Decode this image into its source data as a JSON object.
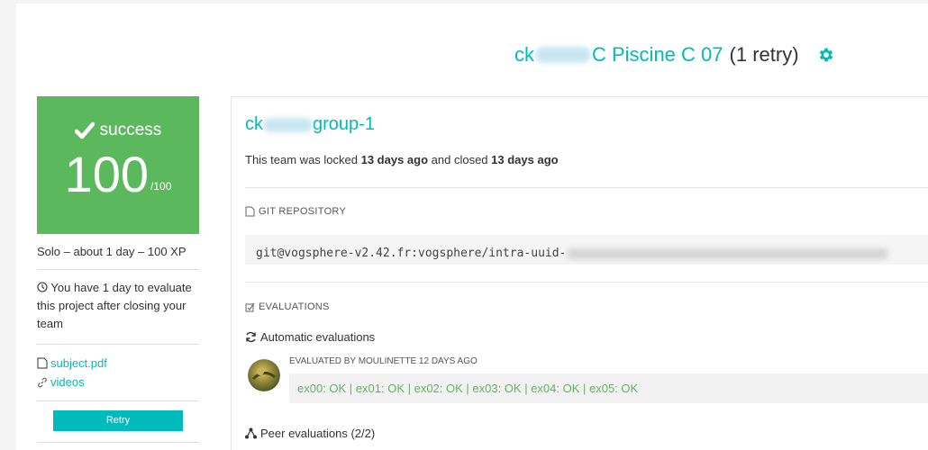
{
  "header": {
    "title_prefix": "ck",
    "title_main": "C Piscine C 07",
    "retry_text": "(1 retry)",
    "settings_icon": "gear-icon"
  },
  "status": {
    "label": "success",
    "score": "100",
    "max": "/100",
    "color": "#5cb85c"
  },
  "info": {
    "solo": "Solo – about 1 day – 100 XP",
    "deadline": "You have 1 day to evaluate this project after closing your team"
  },
  "links": {
    "subject": "subject.pdf",
    "videos": "videos"
  },
  "buttons": {
    "retry": "Retry"
  },
  "team": {
    "name_prefix": "ck",
    "name_suffix": "group-1",
    "locked_text_1": "This team was locked ",
    "locked_time": "13 days ago",
    "locked_text_2": " and closed ",
    "closed_time": "13 days ago"
  },
  "git": {
    "label": "GIT REPOSITORY",
    "url": "git@vogsphere-v2.42.fr:vogsphere/intra-uuid-"
  },
  "evaluations": {
    "label": "EVALUATIONS",
    "automatic_label": "Automatic evaluations",
    "evaluated_by": "EVALUATED BY MOULINETTE 12 DAYS AGO",
    "result": "ex00: OK | ex01: OK | ex02: OK | ex03: OK | ex04: OK | ex05: OK",
    "peer_label": "Peer evaluations (2/2)"
  },
  "colors": {
    "accent": "#00babc",
    "success": "#5cb85c"
  }
}
